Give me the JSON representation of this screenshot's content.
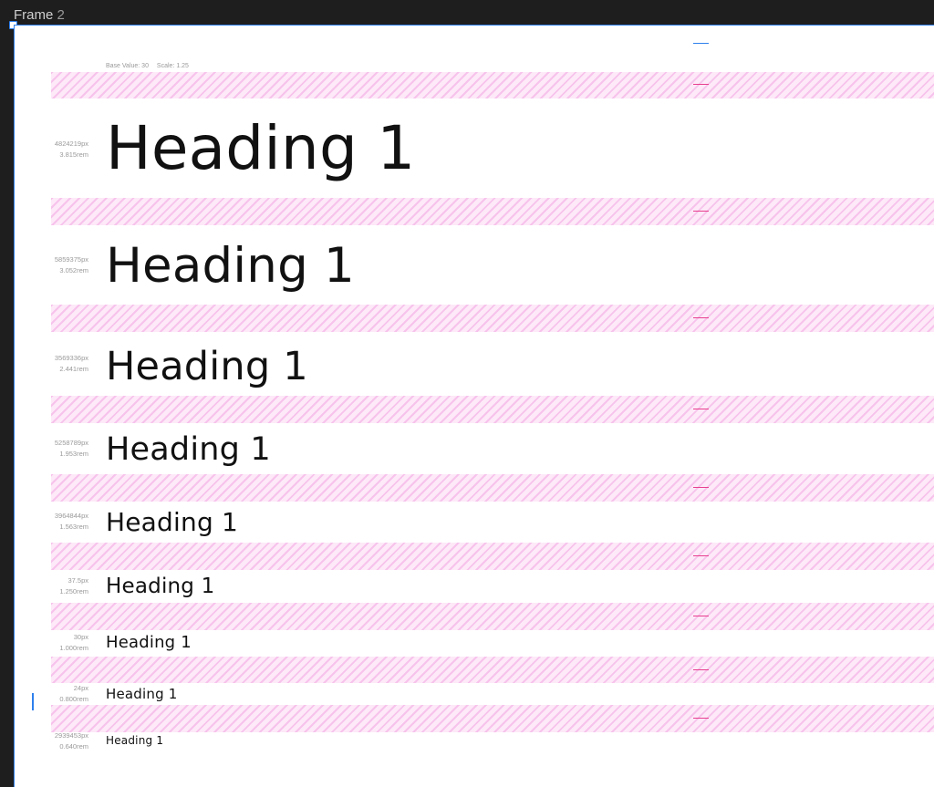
{
  "frame": {
    "title_word": "Frame",
    "title_number": "2"
  },
  "meta": {
    "base_value": "Base Value: 30",
    "scale": "Scale: 1.25"
  },
  "rows": [
    {
      "px": "4824219px",
      "rem": "3.815rem",
      "heading": "Heading 1"
    },
    {
      "px": "5859375px",
      "rem": "3.052rem",
      "heading": "Heading 1"
    },
    {
      "px": "3569336px",
      "rem": "2.441rem",
      "heading": "Heading 1"
    },
    {
      "px": "5258789px",
      "rem": "1.953rem",
      "heading": "Heading 1"
    },
    {
      "px": "3964844px",
      "rem": "1.563rem",
      "heading": "Heading 1"
    },
    {
      "px": "37.5px",
      "rem": "1.250rem",
      "heading": "Heading 1"
    },
    {
      "px": "30px",
      "rem": "1.000rem",
      "heading": "Heading 1"
    },
    {
      "px": "24px",
      "rem": "0.800rem",
      "heading": "Heading 1"
    },
    {
      "px": "2939453px",
      "rem": "0.640rem",
      "heading": "Heading 1"
    }
  ],
  "colors": {
    "selection": "#2f80ed",
    "spacer_stripe": "#f7c3ec",
    "spacer_bg": "#fde9f8",
    "tick": "#e8408f"
  }
}
